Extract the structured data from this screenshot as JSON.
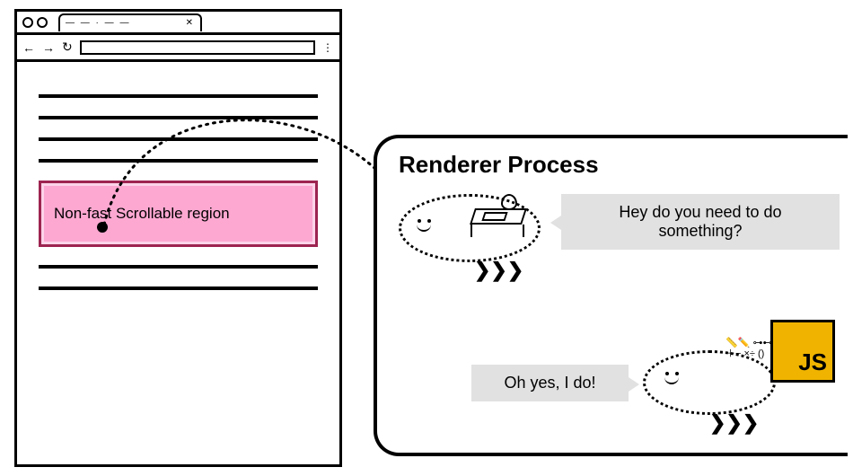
{
  "browser": {
    "tab_placeholder": "— — · — —",
    "close_glyph": "✕",
    "back_glyph": "←",
    "fwd_glyph": "→",
    "reload_glyph": "↻",
    "menu_glyph": "⋮",
    "nfsr_label": "Non-fast Scrollable region"
  },
  "renderer": {
    "title": "Renderer Process",
    "bubble_compositor": "Hey do you need to do something?",
    "bubble_main": "Oh yes, I do!",
    "js_label": "JS",
    "arrow_glyph": "❯❯❯",
    "tools_glyph": "📏✏️\n⊶⊷\n＋−\n×÷ ()"
  },
  "colors": {
    "nfsr_bg": "#fca8d1",
    "nfsr_border": "#9d2450",
    "bubble_bg": "#e1e1e1",
    "js_bg": "#f0b400"
  }
}
